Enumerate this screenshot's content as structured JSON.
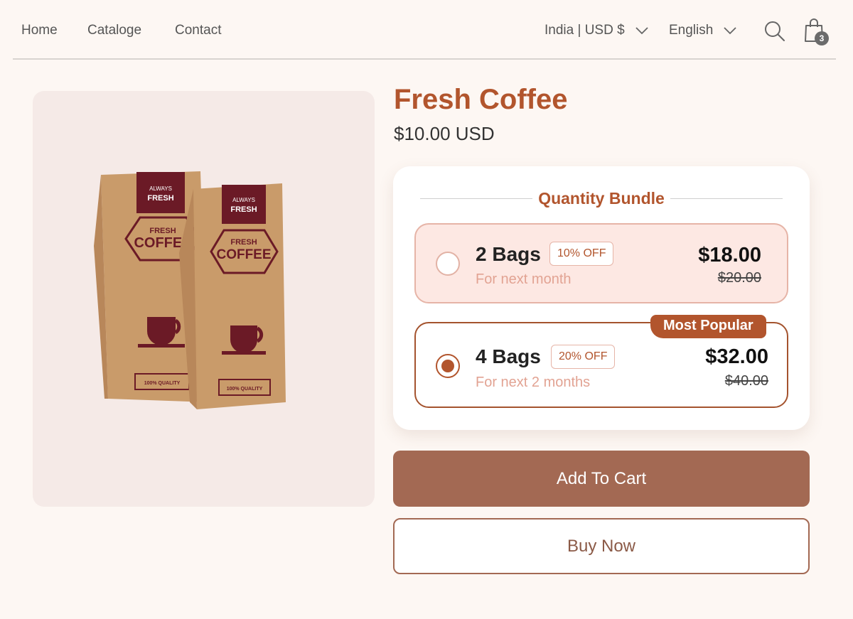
{
  "nav": {
    "items": [
      {
        "label": "Home"
      },
      {
        "label": "Cataloge"
      },
      {
        "label": "Contact"
      }
    ],
    "region_label": "India | USD $",
    "language_label": "English",
    "cart_count": "3",
    "icons": [
      "search-icon",
      "shopping-bag-icon",
      "chevron-down-icon"
    ]
  },
  "product": {
    "title": "Fresh Coffee",
    "price": "$10.00 USD",
    "image": {
      "bag_banner": "ALWAYS",
      "bag_banner_2": "FRESH",
      "bag_label_1": "FRESH",
      "bag_label_2": "COFFEE",
      "bag_quality": "100% QUALITY"
    }
  },
  "bundle": {
    "heading": "Quantity Bundle",
    "options": [
      {
        "name": "2 Bags",
        "discount": "10% OFF",
        "subtitle": "For next month",
        "price": "$18.00",
        "original_price": "$20.00",
        "selected": false
      },
      {
        "name": "4 Bags",
        "discount": "20% OFF",
        "subtitle": "For next 2 months",
        "price": "$32.00",
        "original_price": "$40.00",
        "badge": "Most Popular",
        "selected": true
      }
    ]
  },
  "actions": {
    "add_to_cart": "Add To Cart",
    "buy_now": "Buy Now"
  },
  "colors": {
    "accent": "#b2552d",
    "button": "#a36953",
    "background": "#fdf7f3",
    "bag_brown": "#c99b6a",
    "bag_maroon": "#6b1a26"
  }
}
